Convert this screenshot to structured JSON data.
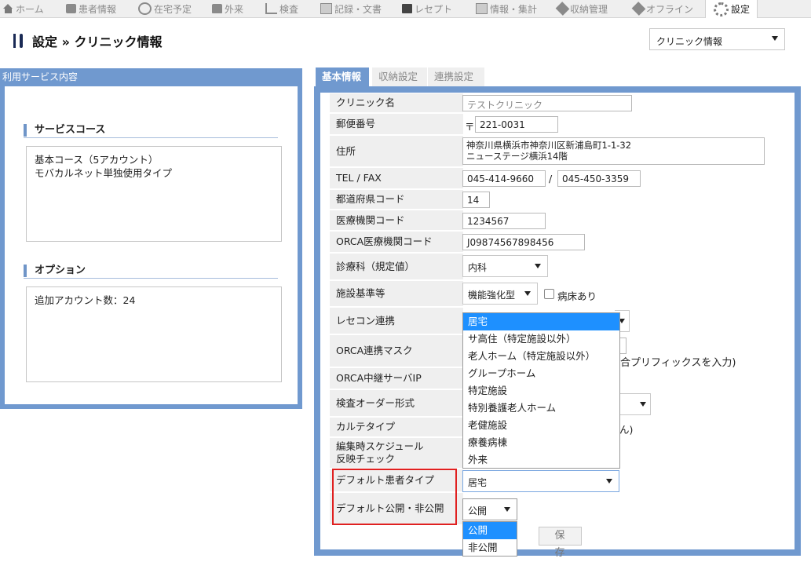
{
  "topnav": {
    "tabs": [
      {
        "label": "ホーム",
        "icon": "home-icon"
      },
      {
        "label": "患者情報",
        "icon": "patient-card-icon"
      },
      {
        "label": "在宅予定",
        "icon": "clock-icon"
      },
      {
        "label": "外来",
        "icon": "lock-icon"
      },
      {
        "label": "検査",
        "icon": "chart-icon"
      },
      {
        "label": "記録・文書",
        "icon": "document-icon"
      },
      {
        "label": "レセプト",
        "icon": "tray-icon"
      },
      {
        "label": "情報・集計",
        "icon": "stats-icon"
      },
      {
        "label": "収納管理",
        "icon": "tag-icon"
      },
      {
        "label": "オフライン",
        "icon": "pen-icon"
      },
      {
        "label": "設定",
        "icon": "gear-icon"
      }
    ],
    "active": "設定"
  },
  "page": {
    "title": "設定 » クリニック情報",
    "select_value": "クリニック情報"
  },
  "left_panel": {
    "header": "利用サービス内容",
    "service_course": {
      "title": "サービスコース",
      "lines": [
        "基本コース（5アカウント）",
        "モバカルネット単独使用タイプ"
      ]
    },
    "options": {
      "title": "オプション",
      "lines": [
        "追加アカウント数：24"
      ]
    }
  },
  "right_tabs": [
    "基本情報",
    "収納設定",
    "連携設定"
  ],
  "form": {
    "clinic_name": {
      "label": "クリニック名",
      "value": "テストクリニック"
    },
    "postal": {
      "label": "郵便番号",
      "prefix": "〒",
      "value": "221-0031"
    },
    "address": {
      "label": "住所",
      "line1": "神奈川県横浜市神奈川区新浦島町1-1-32",
      "line2": "ニューステージ横浜14階"
    },
    "tel_fax": {
      "label": "TEL / FAX",
      "tel": "045-414-9660",
      "sep": "/",
      "fax": "045-450-3359"
    },
    "pref_code": {
      "label": "都道府県コード",
      "value": "14"
    },
    "inst_code": {
      "label": "医療機関コード",
      "value": "1234567"
    },
    "orca_code": {
      "label": "ORCA医療機関コード",
      "value": "J09874567898456"
    },
    "department": {
      "label": "診療科（規定値）",
      "value": "内科"
    },
    "facility_std": {
      "label": "施設基準等",
      "value": "機能強化型",
      "checkbox_label": "病床あり"
    },
    "rececon": {
      "label": "レセコン連携"
    },
    "orca_mask": {
      "label": "ORCA連携マスク",
      "hint": "合プリフィックスを入力)"
    },
    "orca_relay": {
      "label": "ORCA中継サーバIP"
    },
    "exam_order": {
      "label": "検査オーダー形式"
    },
    "karte_type": {
      "label": "カルテタイプ",
      "partial": "ん)"
    },
    "schedule_check": {
      "label_line1": "編集時スケジュール",
      "label_line2": "反映チェック"
    },
    "default_patient_type": {
      "label": "デフォルト患者タイプ",
      "value": "居宅"
    },
    "default_public": {
      "label": "デフォルト公開・非公開",
      "value": "公開"
    },
    "save_label": "保 存"
  },
  "patient_type_dropdown": {
    "options": [
      "居宅",
      "サ高住（特定施設以外）",
      "老人ホーム（特定施設以外）",
      "グループホーム",
      "特定施設",
      "特別養護老人ホーム",
      "老健施設",
      "療養病棟",
      "外来"
    ],
    "highlighted": "居宅"
  },
  "public_dropdown": {
    "options": [
      "公開",
      "非公開"
    ],
    "highlighted": "公開"
  }
}
